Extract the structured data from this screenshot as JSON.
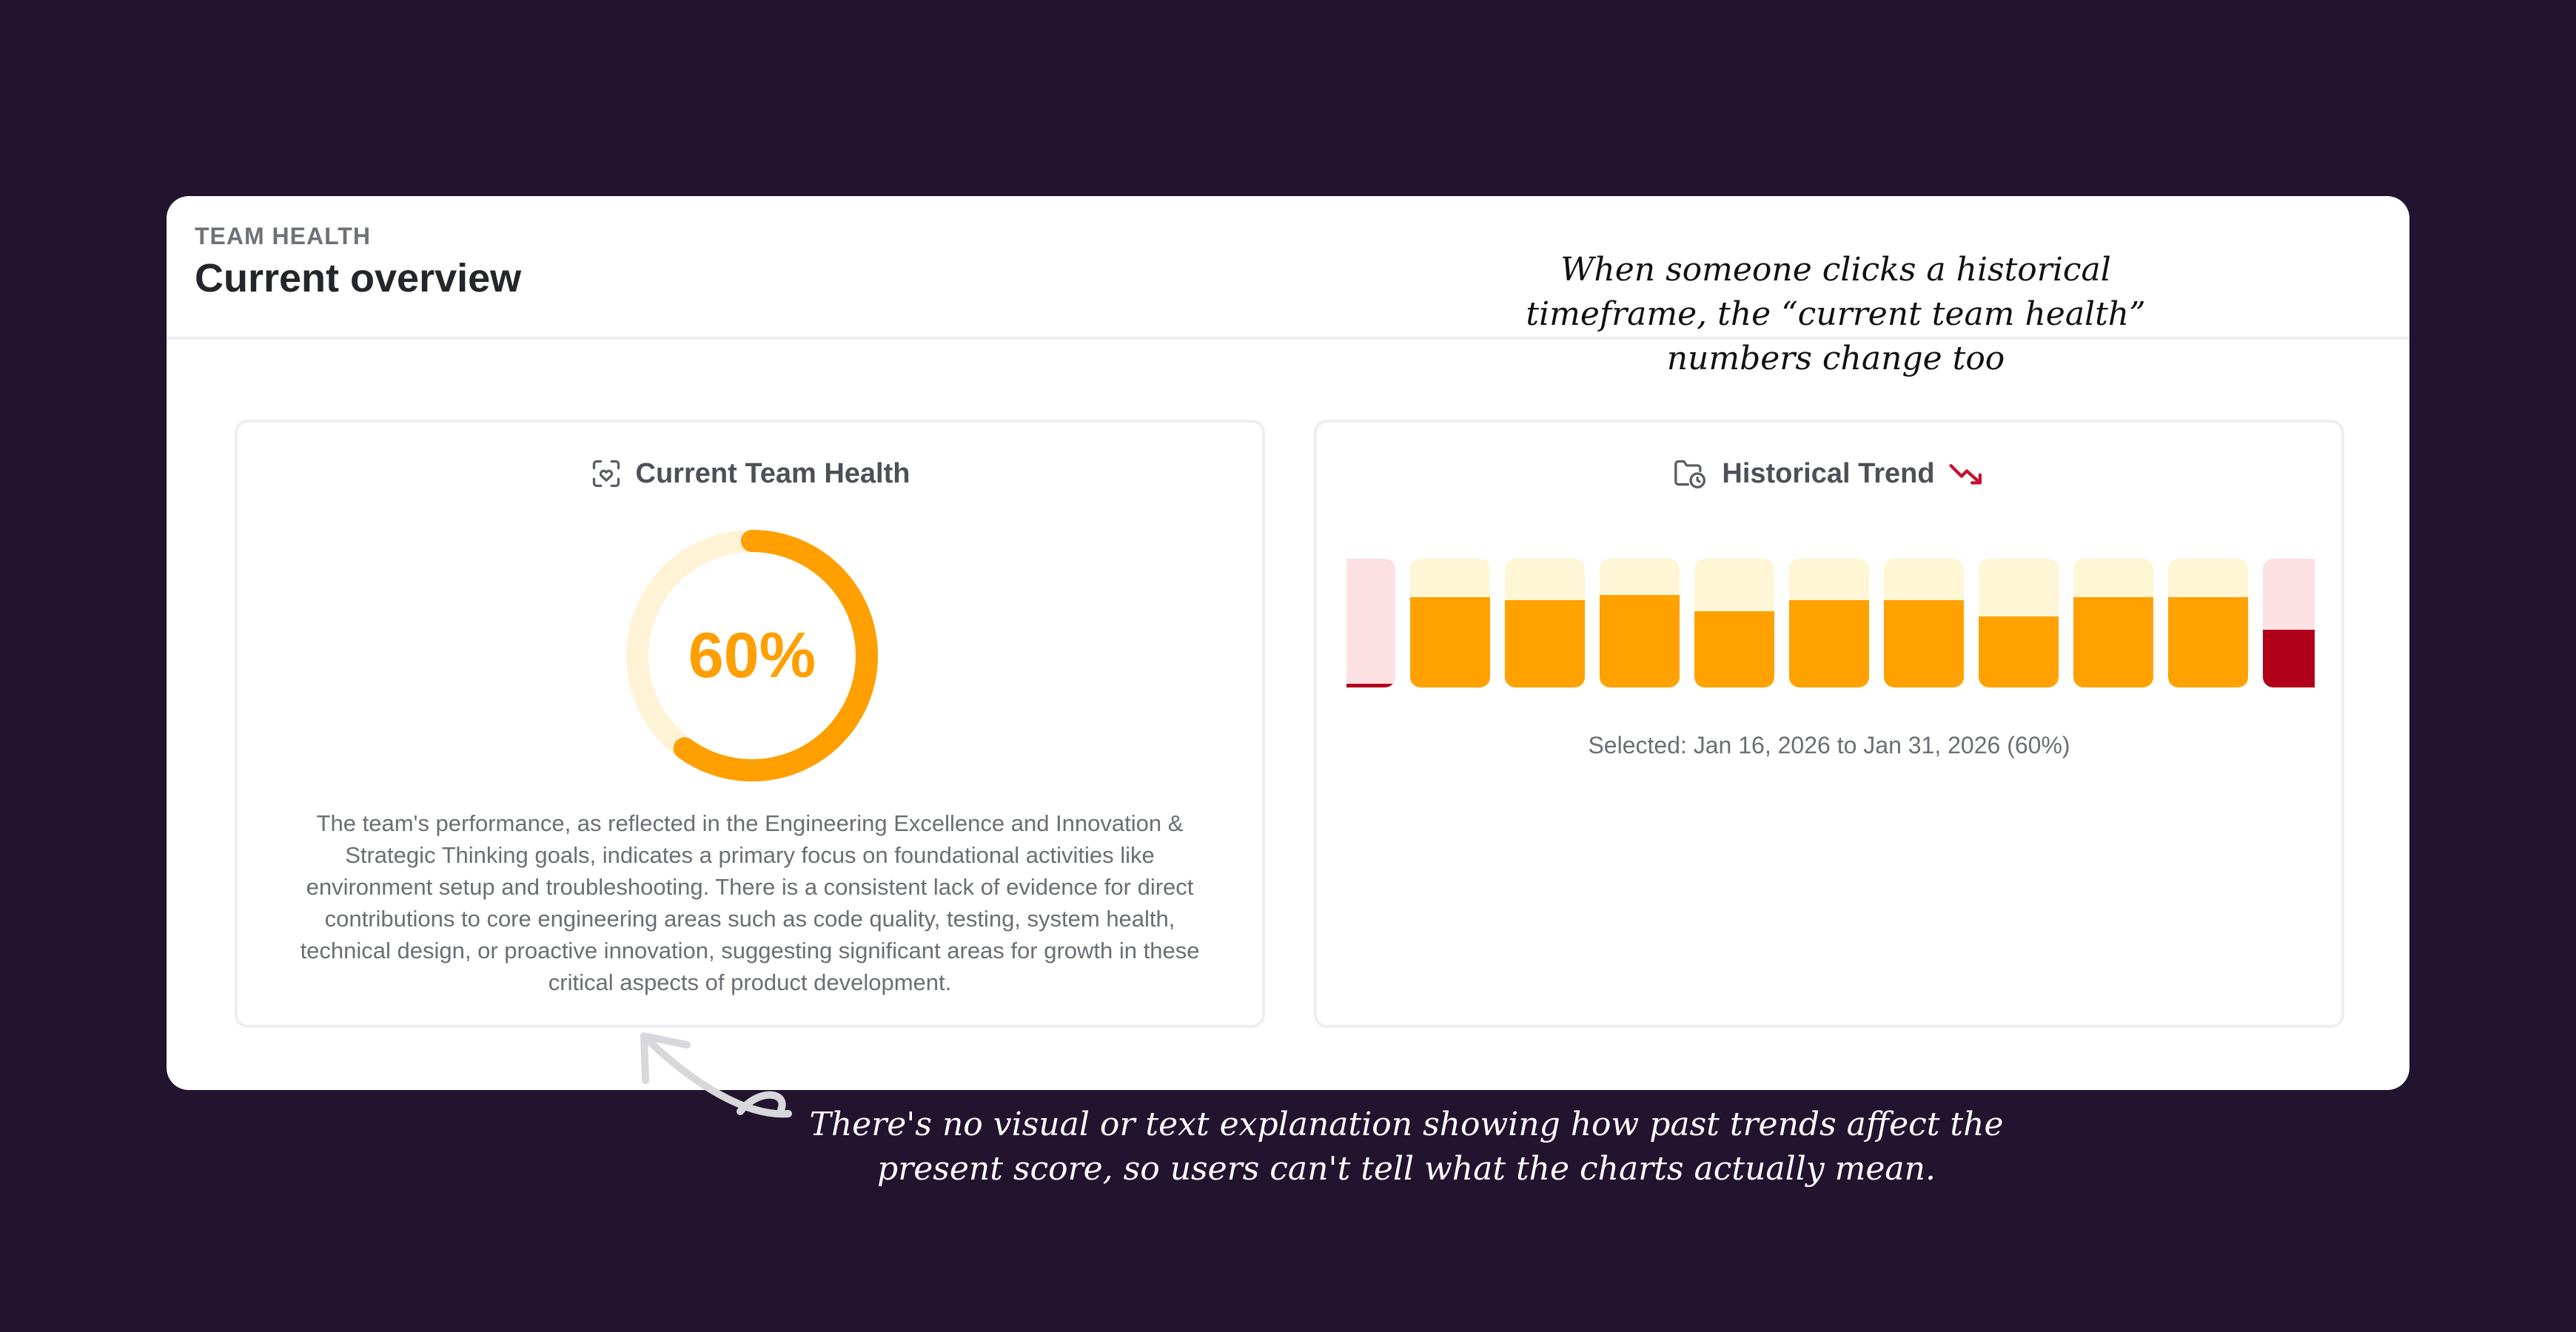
{
  "header": {
    "eyebrow": "TEAM HEALTH",
    "title": "Current overview"
  },
  "current_health": {
    "title": "Current Team Health",
    "icon": "heart-scan-icon",
    "value_text": "60%",
    "value": 60,
    "color": "#ff9f00",
    "track_color": "#fff3d6",
    "description": "The team's performance, as reflected in the Engineering Excellence and Innovation & Strategic Thinking goals, indicates a primary focus on foundational activities like environment setup and troubleshooting. There is a consistent lack of evidence for direct contributions to core engineering areas such as code quality, testing, system health, technical design, or proactive innovation, suggesting significant areas for growth in these critical aspects of product development."
  },
  "historical_trend": {
    "title": "Historical Trend",
    "icon": "folder-clock-icon",
    "trend_icon": "trend-down-icon",
    "selected_text": "Selected: Jan 16, 2026 to Jan 31, 2026 (60%)",
    "colors": {
      "ok_fill": "#ffa200",
      "ok_bg": "#fff6d6",
      "bad_fill": "#b0001a",
      "bad_bg": "#fde0e2"
    }
  },
  "chart_data": {
    "type": "bar",
    "values": [
      3,
      70,
      68,
      72,
      59,
      68,
      68,
      55,
      70,
      70,
      45
    ],
    "status": [
      "bad",
      "ok",
      "ok",
      "ok",
      "ok",
      "ok",
      "ok",
      "ok",
      "ok",
      "ok",
      "bad"
    ],
    "ylim": [
      0,
      100
    ]
  },
  "annotations": {
    "top": "When someone clicks a historical timeframe, the “current team health” numbers change too",
    "bottom": "There's no visual or text explanation showing how past trends affect the present score, so users can't tell what the charts actually mean."
  }
}
